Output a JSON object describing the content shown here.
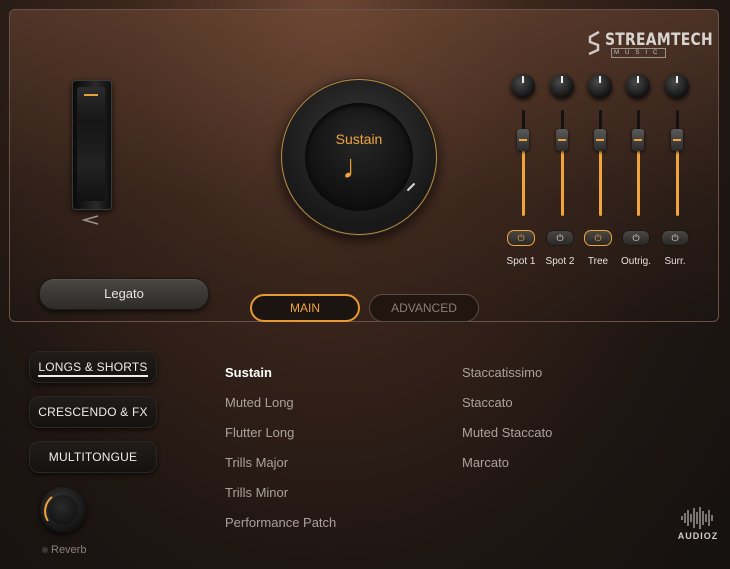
{
  "brand": {
    "name": "STREAMTECH",
    "sub": "MUSIC"
  },
  "legato": {
    "label": "Legato"
  },
  "main_dial": {
    "articulation": "Sustain",
    "icon": "eighth-note-icon",
    "glyph": "♩"
  },
  "mics": [
    {
      "label": "Spot 1",
      "on": true,
      "level": 0.72
    },
    {
      "label": "Spot 2",
      "on": false,
      "level": 0.72
    },
    {
      "label": "Tree",
      "on": true,
      "level": 0.72
    },
    {
      "label": "Outrig.",
      "on": false,
      "level": 0.72
    },
    {
      "label": "Surr.",
      "on": false,
      "level": 0.72
    }
  ],
  "tabs": {
    "main": "MAIN",
    "advanced": "ADVANCED",
    "active": "MAIN"
  },
  "categories": [
    "LONGS & SHORTS",
    "CRESCENDO & FX",
    "MULTITONGUE"
  ],
  "articulations": {
    "left": [
      "Sustain",
      "Muted Long",
      "Flutter Long",
      "Trills Major",
      "Trills Minor",
      "Performance Patch"
    ],
    "right": [
      "Staccatissimo",
      "Staccato",
      "Muted Staccato",
      "Marcato"
    ],
    "selected": "Sustain"
  },
  "reverb": {
    "label": "Reverb"
  },
  "watermark": {
    "text": "AUDIOZ"
  },
  "colors": {
    "accent": "#f0a43c",
    "panel_border": "#6a5248"
  }
}
